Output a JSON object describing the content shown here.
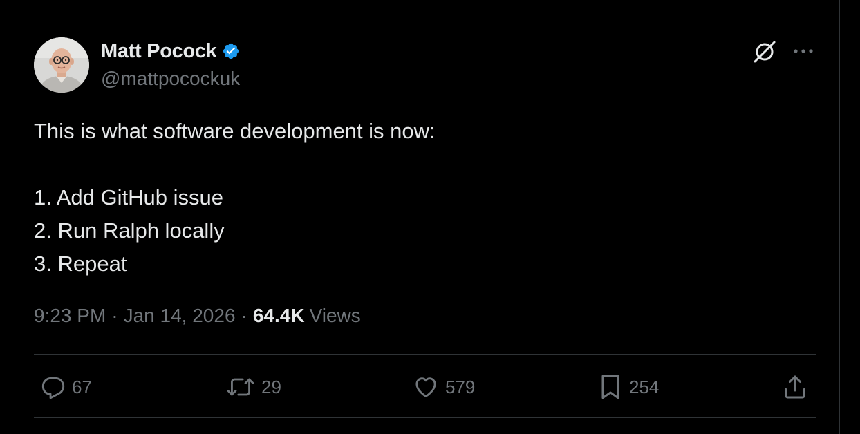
{
  "tweet": {
    "author": {
      "display_name": "Matt Pocock",
      "handle": "@mattpocockuk",
      "verified": true,
      "avatar_icon": "profile-photo"
    },
    "text_lines": [
      "This is what software development is now:",
      "",
      "1. Add GitHub issue",
      "2. Run Ralph locally",
      "3. Repeat"
    ],
    "meta": {
      "time": "9:23 PM",
      "separator": "·",
      "date": "Jan 14, 2026",
      "views_count": "64.4K",
      "views_label": "Views"
    },
    "actions": {
      "replies": "67",
      "reposts": "29",
      "likes": "579",
      "bookmarks": "254"
    }
  },
  "icons": {
    "verified": "verified-badge-icon",
    "grok": "grok-icon",
    "more": "more-icon",
    "reply": "reply-icon",
    "repost": "repost-icon",
    "like": "like-icon",
    "bookmark": "bookmark-icon",
    "share": "share-icon"
  },
  "colors": {
    "background": "#000000",
    "text_primary": "#e7e9ea",
    "text_secondary": "#71767b",
    "divider": "#2f3336",
    "verified_blue": "#1d9bf0"
  }
}
